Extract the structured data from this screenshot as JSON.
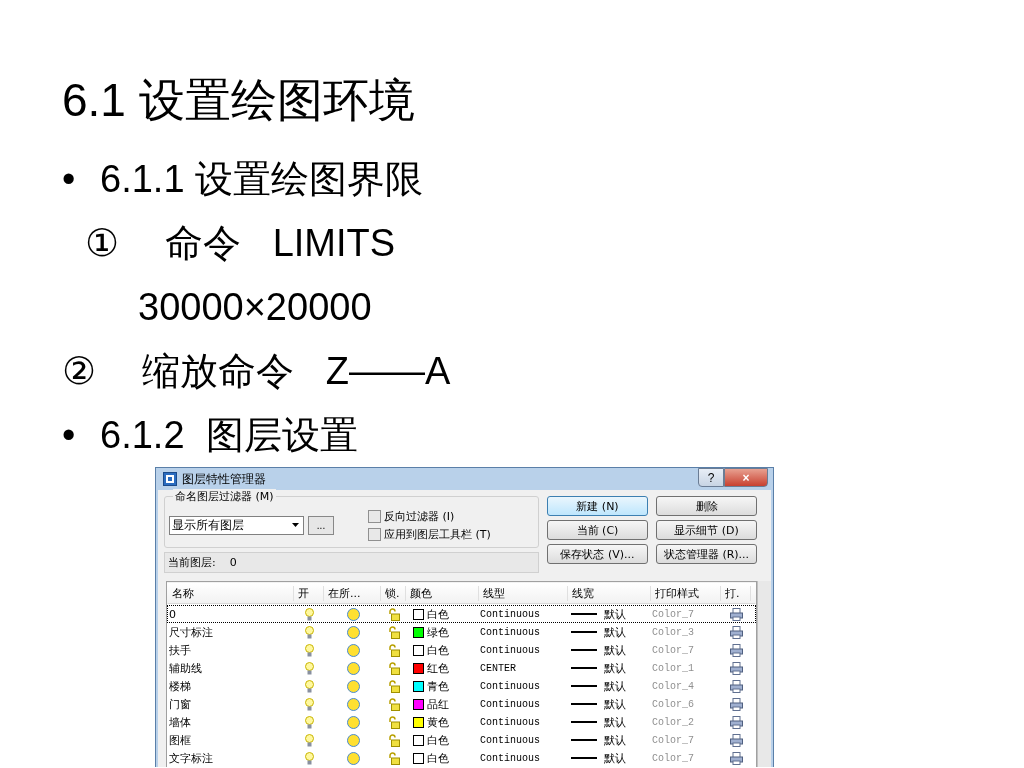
{
  "slide": {
    "title": "6.1 设置绘图环境",
    "lines": [
      {
        "kind": "bullet",
        "marker": "•",
        "text": "6.1.1 设置绘图界限"
      },
      {
        "kind": "sub",
        "marker": "①",
        "text": "命令   LIMITS"
      },
      {
        "kind": "value",
        "text": "30000×20000"
      },
      {
        "kind": "step",
        "marker": "②",
        "text": "缩放命令   Z——A"
      },
      {
        "kind": "bullet",
        "marker": "•",
        "text": "6.1.2  图层设置"
      }
    ]
  },
  "dialog": {
    "title": "图层特性管理器",
    "title_buttons": [
      "?",
      "×"
    ],
    "filter": {
      "label": "命名图层过滤器 (M)",
      "value": "显示所有图层",
      "more": "...",
      "checkboxes": [
        {
          "label": "反向过滤器 (I)",
          "checked": false
        },
        {
          "label": "应用到图层工具栏 (T)",
          "checked": false
        }
      ]
    },
    "buttons": [
      {
        "label": "新建 (N)",
        "default": true
      },
      {
        "label": "删除",
        "default": false
      },
      {
        "label": "当前 (C)",
        "default": false
      },
      {
        "label": "显示细节 (D)",
        "default": false
      },
      {
        "label": "保存状态 (V)...",
        "default": false
      },
      {
        "label": "状态管理器 (R)...",
        "default": false
      }
    ],
    "current_layer": {
      "label": "当前图层:",
      "value": "0"
    },
    "table": {
      "columns": [
        "名称",
        "开",
        "在所...",
        "锁.",
        "颜色",
        "线型",
        "线宽",
        "打印样式",
        "打."
      ],
      "rows": [
        {
          "name": "0",
          "color_name": "白色",
          "color": "#ffffff",
          "linetype": "Continuous",
          "lineweight": "默认",
          "plot_style": "Color_7",
          "selected": true
        },
        {
          "name": "尺寸标注",
          "color_name": "绿色",
          "color": "#00ff00",
          "linetype": "Continuous",
          "lineweight": "默认",
          "plot_style": "Color_3",
          "selected": false
        },
        {
          "name": "扶手",
          "color_name": "白色",
          "color": "#ffffff",
          "linetype": "Continuous",
          "lineweight": "默认",
          "plot_style": "Color_7",
          "selected": false
        },
        {
          "name": "辅助线",
          "color_name": "红色",
          "color": "#ff0000",
          "linetype": "CENTER",
          "lineweight": "默认",
          "plot_style": "Color_1",
          "selected": false
        },
        {
          "name": "楼梯",
          "color_name": "青色",
          "color": "#00ffff",
          "linetype": "Continuous",
          "lineweight": "默认",
          "plot_style": "Color_4",
          "selected": false
        },
        {
          "name": "门窗",
          "color_name": "品红",
          "color": "#ff00ff",
          "linetype": "Continuous",
          "lineweight": "默认",
          "plot_style": "Color_6",
          "selected": false
        },
        {
          "name": "墙体",
          "color_name": "黄色",
          "color": "#ffff00",
          "linetype": "Continuous",
          "lineweight": "默认",
          "plot_style": "Color_2",
          "selected": false
        },
        {
          "name": "图框",
          "color_name": "白色",
          "color": "#ffffff",
          "linetype": "Continuous",
          "lineweight": "默认",
          "plot_style": "Color_7",
          "selected": false
        },
        {
          "name": "文字标注",
          "color_name": "白色",
          "color": "#ffffff",
          "linetype": "Continuous",
          "lineweight": "默认",
          "plot_style": "Color_7",
          "selected": false
        }
      ]
    }
  }
}
